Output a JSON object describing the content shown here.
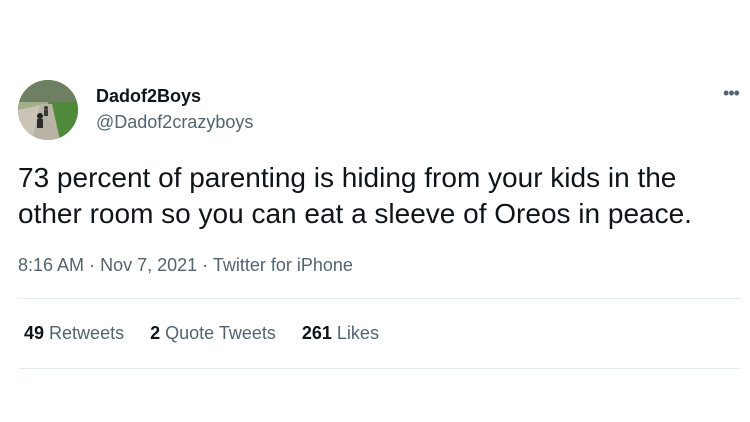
{
  "tweet": {
    "display_name": "Dadof2Boys",
    "handle": "@Dadof2crazyboys",
    "more_icon": "ellipsis-icon",
    "text": "73 percent of parenting is hiding from your kids in the other room so you can eat a sleeve of Oreos in peace.",
    "time": "8:16 AM",
    "separator": "·",
    "date": "Nov 7, 2021",
    "source": "Twitter for iPhone"
  },
  "stats": {
    "retweets_count": "49",
    "retweets_label": "Retweets",
    "quote_tweets_count": "2",
    "quote_tweets_label": "Quote Tweets",
    "likes_count": "261",
    "likes_label": "Likes"
  }
}
